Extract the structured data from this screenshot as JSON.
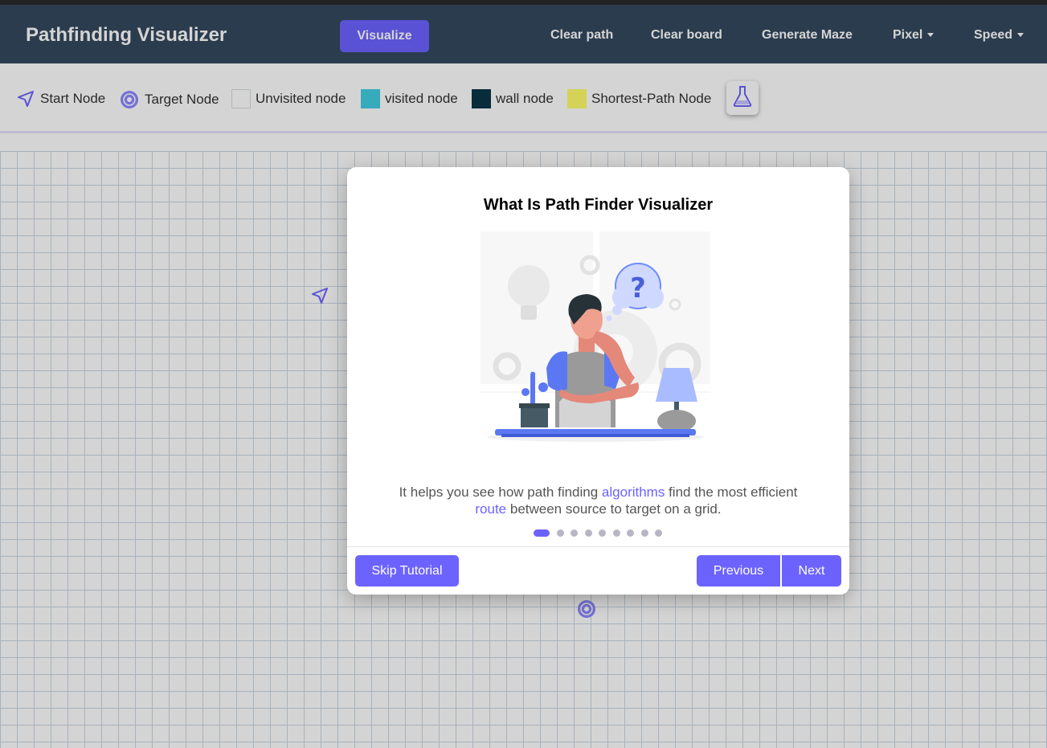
{
  "navbar": {
    "brand": "Pathfinding Visualizer",
    "visualize_label": "Visualize",
    "clear_path": "Clear path",
    "clear_board": "Clear board",
    "generate_maze": "Generate Maze",
    "pixel": "Pixel",
    "speed": "Speed"
  },
  "legend": {
    "start": "Start Node",
    "target": "Target Node",
    "unvisited": "Unvisited node",
    "visited": "visited node",
    "wall": "wall node",
    "shortest": "Shortest-Path Node"
  },
  "colors": {
    "navbar": "#34495e",
    "accent": "#6c63ff",
    "visited": "#40cee3",
    "wall": "#0c3547",
    "shortest": "#fffe6a",
    "unvisited": "#ffffff"
  },
  "icons": {
    "start": "navigation-arrow-icon",
    "target": "target-circle-icon",
    "algorithm": "flask-icon"
  },
  "tutorial": {
    "title": "What Is Path Finder Visualizer",
    "text_part1": "It helps you see how path finding ",
    "text_highlight1": "algorithms",
    "text_part2": " find the most efficient ",
    "text_highlight2": "route",
    "text_part3": " between source to target on a grid.",
    "step_total": 9,
    "step_current": 1,
    "skip_label": "Skip Tutorial",
    "previous_label": "Previous",
    "next_label": "Next"
  }
}
